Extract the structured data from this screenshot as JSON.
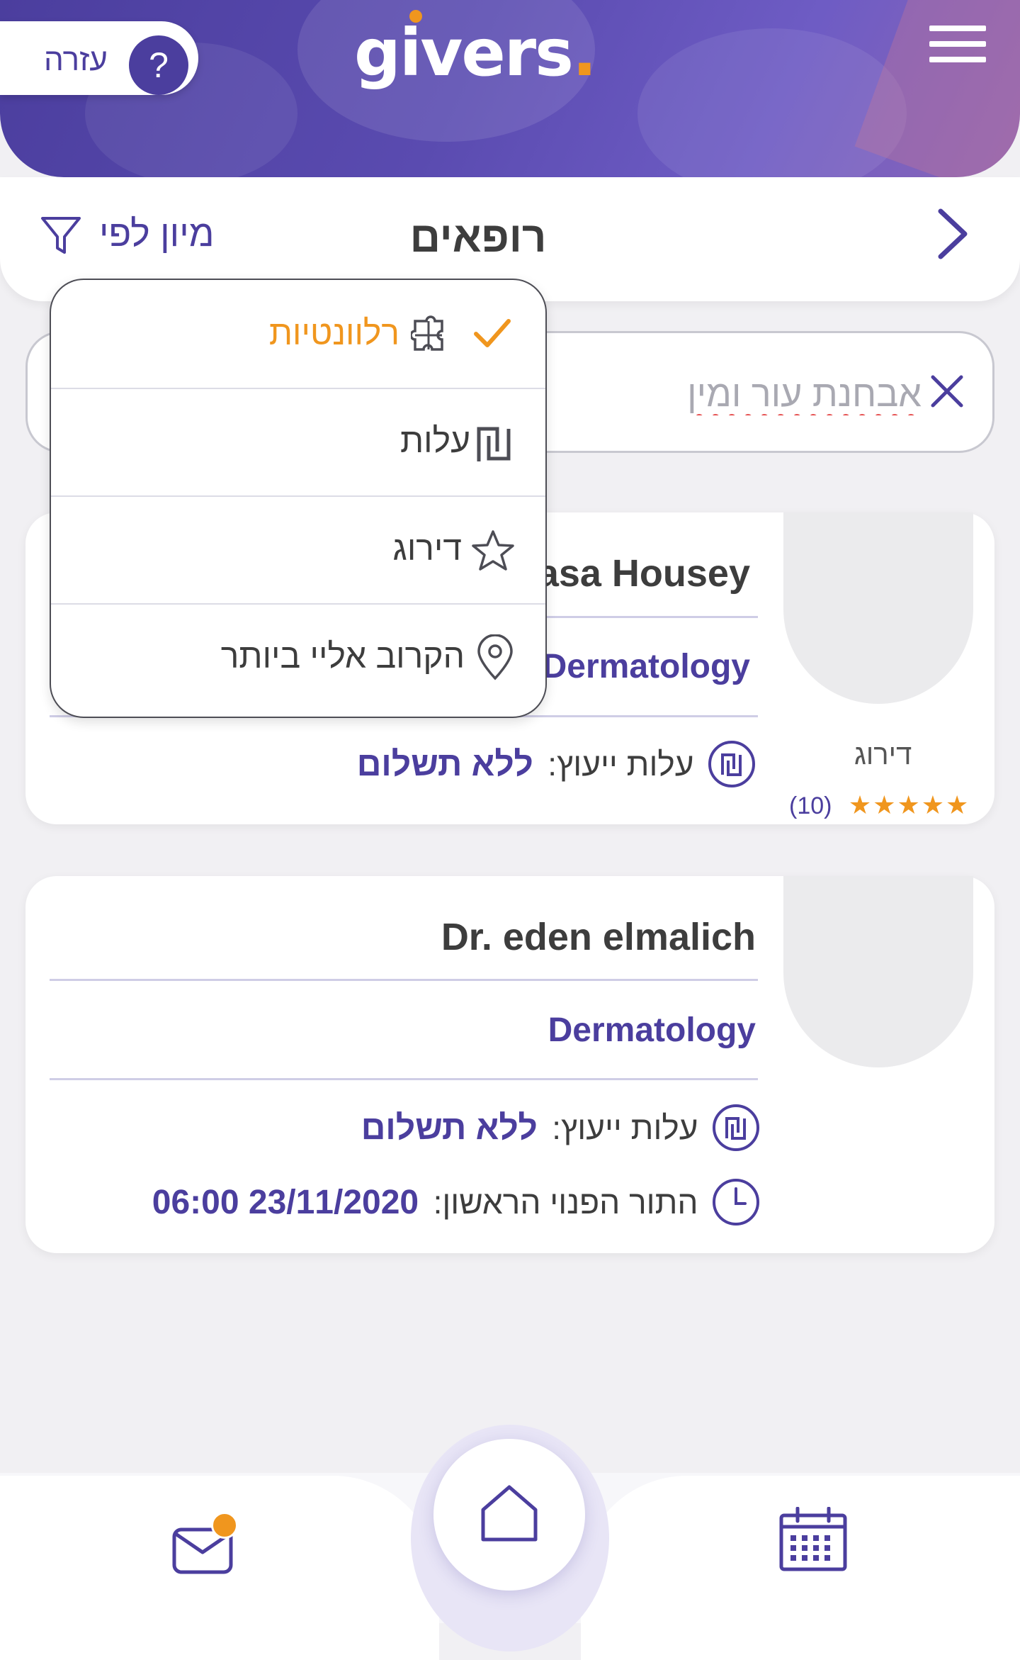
{
  "header": {
    "logo_text": "givers",
    "logo_dot": ".",
    "help_label": "עזרה",
    "help_symbol": "?",
    "menu_icon": "hamburger-menu-icon"
  },
  "titlebar": {
    "title": "רופאים",
    "sort_label": "מיון לפי",
    "back_icon": "chevron-right-icon",
    "filter_icon": "filter-icon"
  },
  "search": {
    "value": "אבחנת עור ומין",
    "clear_icon": "close-icon"
  },
  "sort_menu": {
    "items": [
      {
        "label": "רלוונטיות",
        "icon": "puzzle-icon",
        "selected": true
      },
      {
        "label": "עלות",
        "icon": "shekel-icon",
        "selected": false
      },
      {
        "label": "דירוג",
        "icon": "star-outline-icon",
        "selected": false
      },
      {
        "label": "הקרוב אליי ביותר",
        "icon": "location-pin-icon",
        "selected": false
      }
    ],
    "check_icon": "checkmark-icon"
  },
  "doctors": [
    {
      "name": "asa Housey",
      "specialty": "Dermatology",
      "cost_label": "עלות ייעוץ:",
      "cost_value": "ללא תשלום",
      "rating_label": "דירוג",
      "stars": "★★★★★",
      "rating_value": 5,
      "rating_count": "(10)"
    },
    {
      "name": "Dr. eden elmalich",
      "specialty": "Dermatology",
      "cost_label": "עלות ייעוץ:",
      "cost_value": "ללא תשלום",
      "slot_label": "התור הפנוי הראשון:",
      "slot_value": "23/11/2020 06:00"
    }
  ],
  "bottom_nav": {
    "items": [
      {
        "name": "messages",
        "icon": "envelope-icon",
        "badge": true
      },
      {
        "name": "home",
        "icon": "home-icon"
      },
      {
        "name": "calendar",
        "icon": "calendar-icon"
      }
    ]
  },
  "colors": {
    "primary": "#4b3e9e",
    "accent": "#f0961e",
    "background": "#f1f0f3"
  }
}
